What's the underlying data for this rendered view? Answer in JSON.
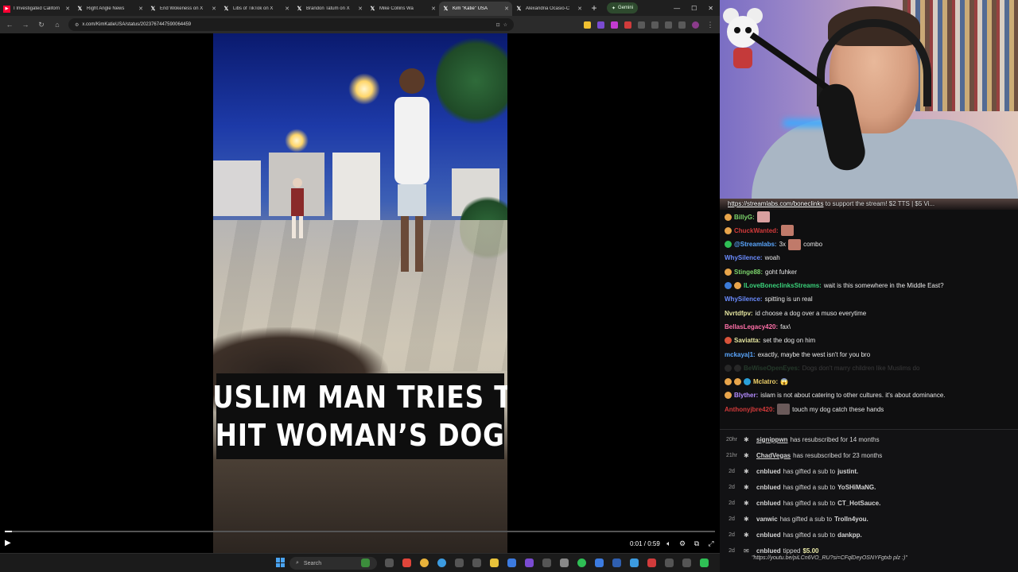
{
  "browser": {
    "tabs": [
      {
        "label": "I Investigated Californ",
        "icon": "youtube-icon",
        "color": "#ff0033",
        "active": false
      },
      {
        "label": "Right Angle News",
        "icon": "x-logo-icon",
        "color": "#000000",
        "active": false
      },
      {
        "label": "End Wokeness on X",
        "icon": "x-logo-icon",
        "color": "#000000",
        "active": false
      },
      {
        "label": "Libs of TikTok on X",
        "icon": "x-logo-icon",
        "color": "#000000",
        "active": false
      },
      {
        "label": "Brandon Tatum on X",
        "icon": "x-logo-icon",
        "color": "#000000",
        "active": false
      },
      {
        "label": "Mike Collins Wa",
        "icon": "x-logo-icon",
        "color": "#000000",
        "active": false
      },
      {
        "label": "Kim \"Katie\" USA",
        "icon": "x-logo-icon",
        "color": "#000000",
        "active": true
      },
      {
        "label": "Alexandria Ocasio-C",
        "icon": "x-logo-icon",
        "color": "#000000",
        "active": false
      }
    ],
    "gemini_label": "Gemini",
    "url": "x.com/KimKatieUSA/status/2023767447590064459"
  },
  "video": {
    "caption_line1": "MUSLIM MAN TRIES TO",
    "caption_line2": "HIT WOMAN’S DOG",
    "time": "0:01 / 0:59",
    "progress_fraction": 0.01
  },
  "taskbar": {
    "search_placeholder": "Search"
  },
  "chat": {
    "banner_link": "https://streamlabs.com/boneclinks",
    "banner_text": " to support the stream! $2 TTS | $5 Vi...",
    "messages": [
      {
        "user": "BillyG:",
        "color": "#7bd36b",
        "text": "",
        "badges": [
          "#e8a54b"
        ],
        "emote": "#d9a0a0"
      },
      {
        "user": "ChuckWanted:",
        "color": "#d23a3a",
        "text": "",
        "badges": [
          "#e8a54b"
        ],
        "emote": "#c07a6a"
      },
      {
        "user": "@Streamlabs:",
        "color": "#5aa7ff",
        "text": "3x",
        "after_emote": "combo",
        "badges": [
          "#2fbf55"
        ],
        "emote": "#c07a6a"
      },
      {
        "user": "WhySilence:",
        "color": "#6b8cff",
        "text": "woah",
        "badges": []
      },
      {
        "user": "Stinge88:",
        "color": "#7bd36b",
        "text": "goht fuhker",
        "badges": [
          "#e8a54b"
        ]
      },
      {
        "user": "ILoveBoneclinksStreams:",
        "color": "#3ad17a",
        "text": "wait is this somewhere in the Middle East?",
        "badges": [
          "#3b7bd9",
          "#e8a54b"
        ]
      },
      {
        "user": "WhySilence:",
        "color": "#6b8cff",
        "text": "spitting is un real",
        "badges": []
      },
      {
        "user": "Nvrtdfpv:",
        "color": "#e6e6a0",
        "text": "id choose a dog over a muso everytime",
        "badges": []
      },
      {
        "user": "BellasLegacy420:",
        "color": "#ff6fa8",
        "text": "fax\\",
        "badges": []
      },
      {
        "user": "Saviatta:",
        "color": "#e6e6a0",
        "text": "set the dog on him",
        "badges": [
          "#d9533a"
        ]
      },
      {
        "user": "mckaya|1:",
        "color": "#5aa7ff",
        "text": "exactly, maybe the west isn't for you bro",
        "badges": []
      },
      {
        "user": "BeWiseOpenEyes:",
        "color": "#3f6d4a",
        "text": "Dogs don't marry children like Muslims do",
        "badges": [
          "#444444",
          "#444444"
        ],
        "dim": true
      },
      {
        "user": "Mclatro:",
        "color": "#f2d36a",
        "text": "😱",
        "badges": [
          "#e8a54b",
          "#e8a54b",
          "#2aa0d9"
        ]
      },
      {
        "user": "Blyther:",
        "color": "#b48cff",
        "text": "islam is not about catering to other cultures. it's about dominance.",
        "badges": [
          "#e8a54b"
        ]
      },
      {
        "user": "Anthonyjbre420:",
        "color": "#d23a3a",
        "text": "touch my dog catch these hands",
        "badges": [],
        "emote": "#6a5a5a"
      }
    ]
  },
  "activity": {
    "rows": [
      {
        "time": "20hr",
        "user": "signippwn",
        "text": "has resubscribed for 14 months",
        "underline": true
      },
      {
        "time": "21hr",
        "user": "ChadVegas",
        "text": "has resubscribed for 23 months",
        "underline": true
      },
      {
        "time": "2d",
        "user": "cnblued",
        "text": "has gifted a sub to",
        "target": "justint."
      },
      {
        "time": "2d",
        "user": "cnblued",
        "text": "has gifted a sub to",
        "target": "YoSHiMaNG."
      },
      {
        "time": "2d",
        "user": "cnblued",
        "text": "has gifted a sub to",
        "target": "CT_HotSauce."
      },
      {
        "time": "2d",
        "user": "vanwic",
        "text": "has gifted a sub to",
        "target": "TrolIn4you."
      },
      {
        "time": "2d",
        "user": "cnblued",
        "text": "has gifted a sub to",
        "target": "dankpp."
      },
      {
        "time": "2d",
        "user": "cnblued",
        "text": "tipped",
        "target": "$5.00"
      }
    ],
    "tip_message": "\"https://youtu.be/piLCn6VO_RU?si=CFqlDeyOSNYFgtxb plz :)\""
  }
}
